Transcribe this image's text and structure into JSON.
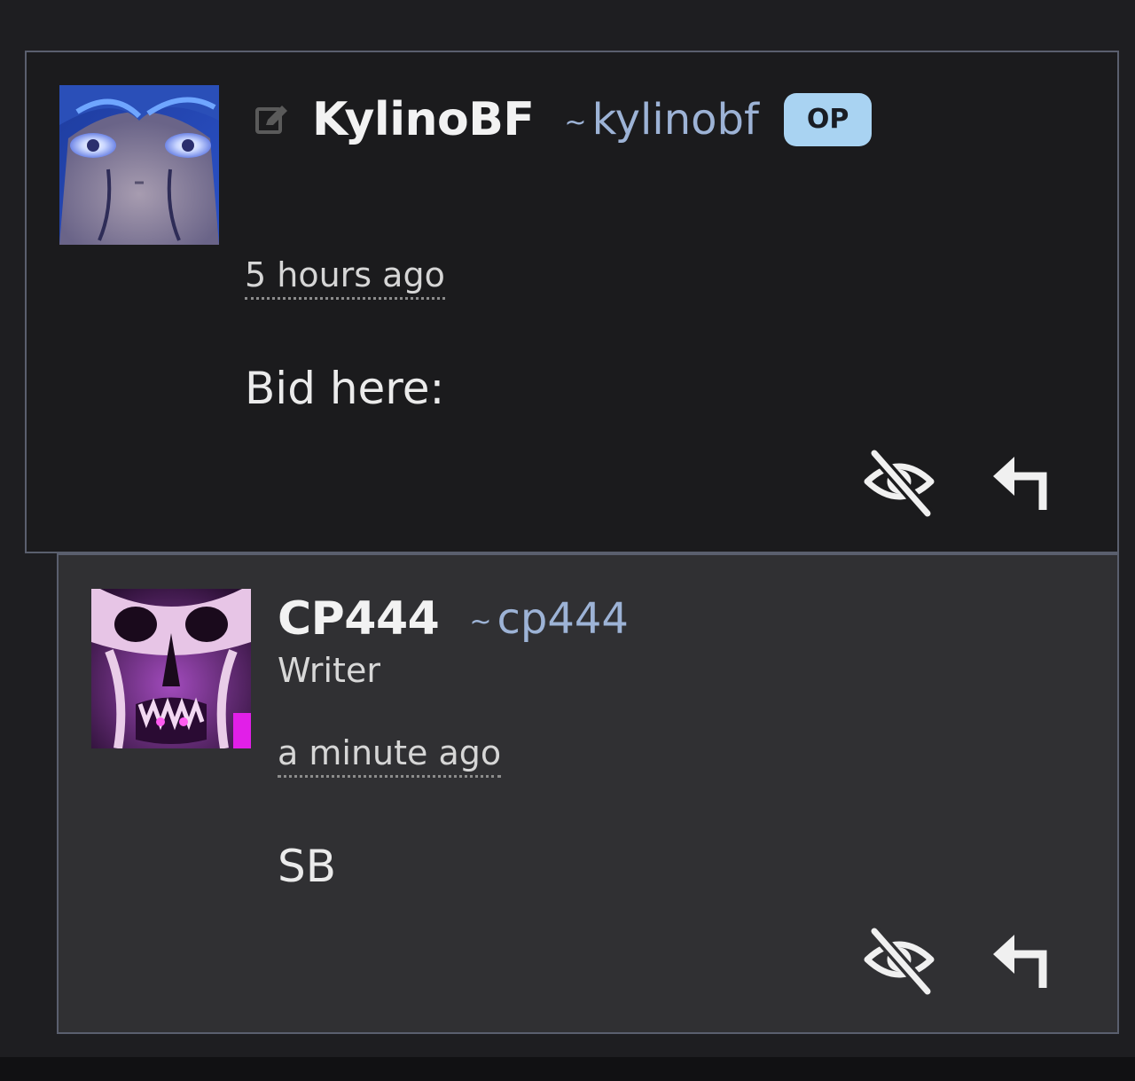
{
  "comments": [
    {
      "display_name": "KylinoBF",
      "handle_tilde": "~",
      "handle": "kylinobf",
      "badge": "OP",
      "timestamp": "5 hours ago",
      "body": "Bid here:",
      "icons": {
        "edit": "edit-icon",
        "hide": "eye-slash-icon",
        "reply": "reply-arrow-icon"
      }
    },
    {
      "display_name": "CP444",
      "handle_tilde": "~",
      "handle": "cp444",
      "user_title": "Writer",
      "timestamp": "a minute ago",
      "body": "SB",
      "icons": {
        "hide": "eye-slash-icon",
        "reply": "reply-arrow-icon"
      }
    }
  ],
  "colors": {
    "page_background": "#1e1e21",
    "parent_comment_background": "#1b1b1d",
    "reply_comment_background": "#303033",
    "border": "#5a5f6e",
    "handle": "#9db3d6",
    "op_badge": "#a9d3f2"
  }
}
